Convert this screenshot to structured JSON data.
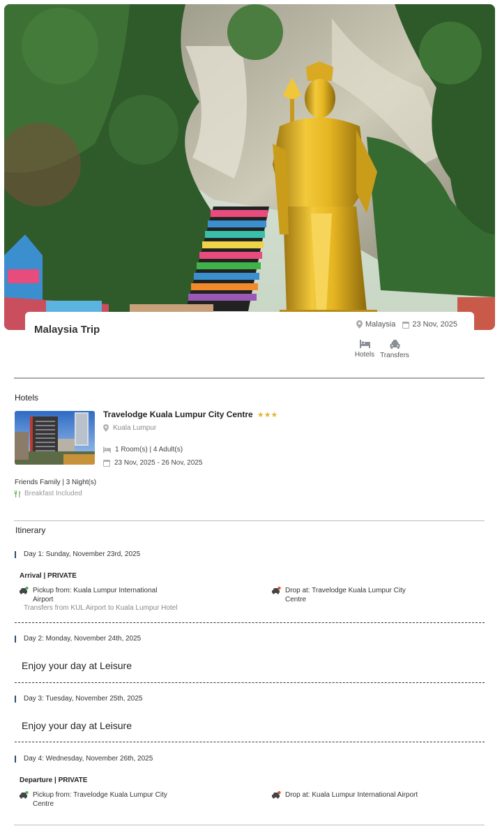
{
  "trip": {
    "title": "Malaysia Trip",
    "destination": "Malaysia",
    "date": "23 Nov, 2025",
    "services": [
      {
        "label": "Hotels",
        "icon": "bed-icon"
      },
      {
        "label": "Transfers",
        "icon": "taxi-icon"
      }
    ]
  },
  "hotels": {
    "section_title": "Hotels",
    "name": "Travelodge Kuala Lumpur City Centre",
    "stars": "★★★",
    "location": "Kuala Lumpur",
    "rooms": "1 Room(s) | 4 Adult(s)",
    "dates": "23 Nov, 2025 - 26 Nov, 2025",
    "party": "Friends Family | 3 Night(s)",
    "meal": "Breakfast Included"
  },
  "itinerary": {
    "section_title": "Itinerary",
    "days": [
      {
        "heading": "Day 1: Sunday, November 23rd, 2025",
        "service_title": "Arrival | PRIVATE",
        "pickup": "Pickup from: Kuala Lumpur International Airport",
        "drop": "Drop at: Travelodge Kuala Lumpur City Centre",
        "note": "Transfers from KUL Airport to Kuala Lumpur Hotel"
      },
      {
        "heading": "Day 2: Monday, November 24th, 2025",
        "leisure": "Enjoy your day at Leisure"
      },
      {
        "heading": "Day 3: Tuesday, November 25th, 2025",
        "leisure": "Enjoy your day at Leisure"
      },
      {
        "heading": "Day 4: Wednesday, November 26th, 2025",
        "service_title": "Departure | PRIVATE",
        "pickup": "Pickup from: Travelodge Kuala Lumpur City Centre",
        "drop": "Drop at: Kuala Lumpur International Airport"
      }
    ]
  },
  "colors": {
    "accent_bar": "#2d4a6b",
    "star": "#e4b43a",
    "pickup_dot": "#4caf50",
    "drop_dot": "#e0532a",
    "meal_icon": "#6bb35a"
  }
}
